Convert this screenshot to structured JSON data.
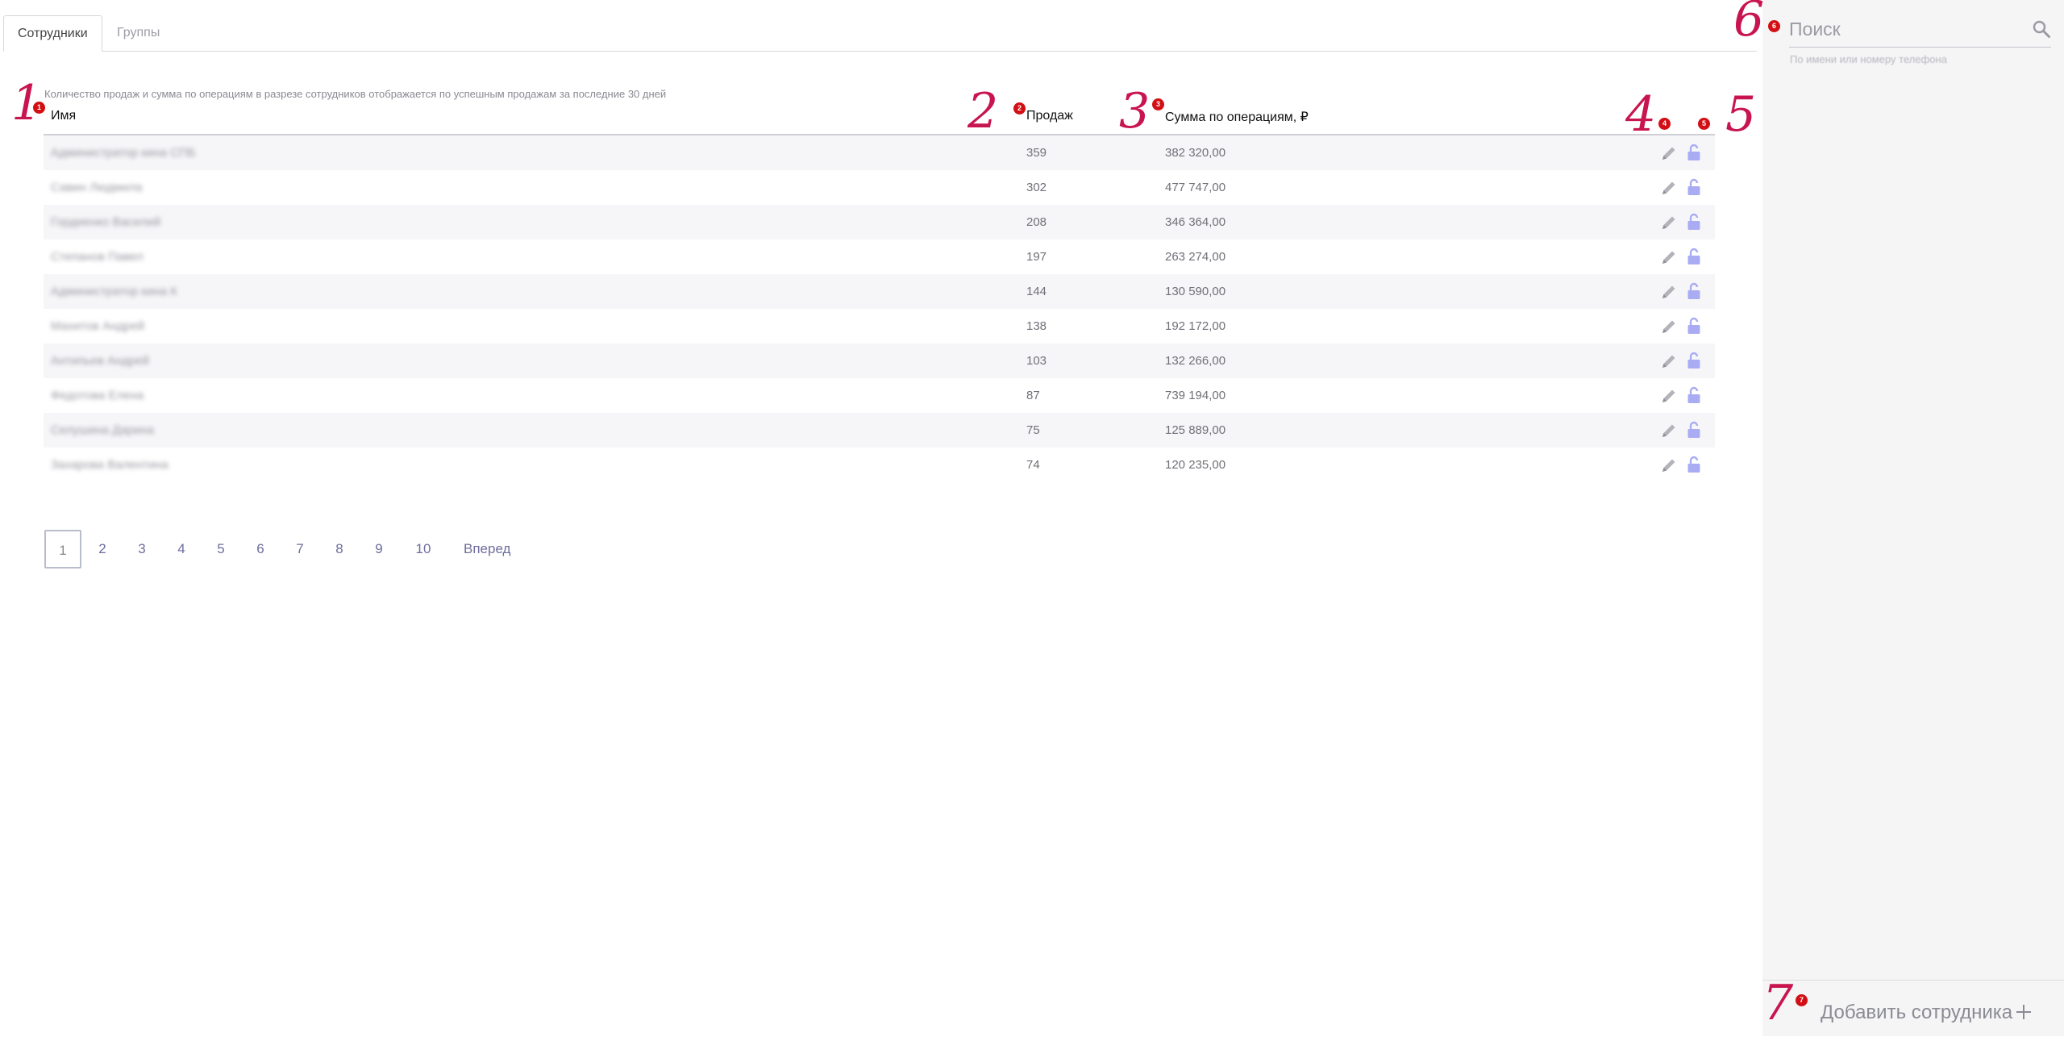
{
  "tabs": [
    {
      "label": "Сотрудники",
      "active": true
    },
    {
      "label": "Группы",
      "active": false
    }
  ],
  "note": "Количество продаж и сумма по операциям в разрезе сотрудников отображается по успешным продажам за последние 30 дней",
  "table": {
    "columns": {
      "name": "Имя",
      "sales": "Продаж",
      "sum": "Сумма по операциям, ₽"
    },
    "rows": [
      {
        "name": "Администратор кина СПБ",
        "sales": "359",
        "sum": "382 320,00"
      },
      {
        "name": "Савин Людмила",
        "sales": "302",
        "sum": "477 747,00"
      },
      {
        "name": "Гордиенко Василий",
        "sales": "208",
        "sum": "346 364,00"
      },
      {
        "name": "Степанов Павел",
        "sales": "197",
        "sum": "263 274,00"
      },
      {
        "name": "Администратор кина К",
        "sales": "144",
        "sum": "130 590,00"
      },
      {
        "name": "Махитов Андрей",
        "sales": "138",
        "sum": "192 172,00"
      },
      {
        "name": "Антипьев Андрей",
        "sales": "103",
        "sum": "132 266,00"
      },
      {
        "name": "Федотова Елена",
        "sales": "87",
        "sum": "739 194,00"
      },
      {
        "name": "Селушина Дарина",
        "sales": "75",
        "sum": "125 889,00"
      },
      {
        "name": "Захарова Валентина",
        "sales": "74",
        "sum": "120 235,00"
      }
    ]
  },
  "pagination": {
    "pages": [
      "1",
      "2",
      "3",
      "4",
      "5",
      "6",
      "7",
      "8",
      "9",
      "10"
    ],
    "current": "1",
    "next_label": "Вперед"
  },
  "sidebar": {
    "search_placeholder": "Поиск",
    "search_hint": "По имени или номеру телефона",
    "add_label": "Добавить сотрудника"
  },
  "annotations": {
    "badges": [
      "1",
      "2",
      "3",
      "4",
      "5",
      "6",
      "7"
    ],
    "handwritten": [
      "1",
      "2",
      "3",
      "4",
      "5",
      "6",
      "7"
    ]
  },
  "colors": {
    "accent_link": "#6d6d9e",
    "lock_icon": "#9fa3f0",
    "badge": "#d20f14",
    "handwriting": "#c8144f"
  },
  "icons": {
    "edit": "pencil-icon",
    "lock": "unlock-icon",
    "search": "search-icon",
    "add": "plus-icon"
  }
}
